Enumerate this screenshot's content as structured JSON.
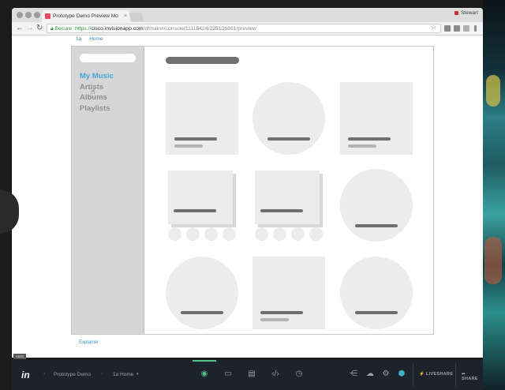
{
  "browser": {
    "tab_title": "Prototype Demo Preview Mo",
    "tab_close": "×",
    "user_name": "Stewart",
    "secure_label": "Secure",
    "url_scheme": "https://",
    "url_host": "cisco.invisionapp.com",
    "url_path": "/d/main#/console/11115424/235126861/preview",
    "back": "←",
    "forward": "→",
    "reload": "↻",
    "star": "☆"
  },
  "breadcrumb": {
    "screen_id": "1a",
    "screen_name": "Home"
  },
  "prototype": {
    "sidebar_items": [
      {
        "label": "My Music"
      },
      {
        "label": "Artists"
      },
      {
        "label": "Albums"
      },
      {
        "label": "Playlists"
      }
    ]
  },
  "explainer_link": "Explainer",
  "hide_label": "HIDE",
  "invision_bar": {
    "logo": "in",
    "project": "Prototype Demo",
    "screen": "1a Home",
    "screen_caret": "▾",
    "liveshare": "LIVESHARE",
    "share": "SHARE"
  },
  "colors": {
    "accent": "#3ea8d8",
    "brand_green": "#4fc48b",
    "bar_bg": "#1e222a"
  }
}
